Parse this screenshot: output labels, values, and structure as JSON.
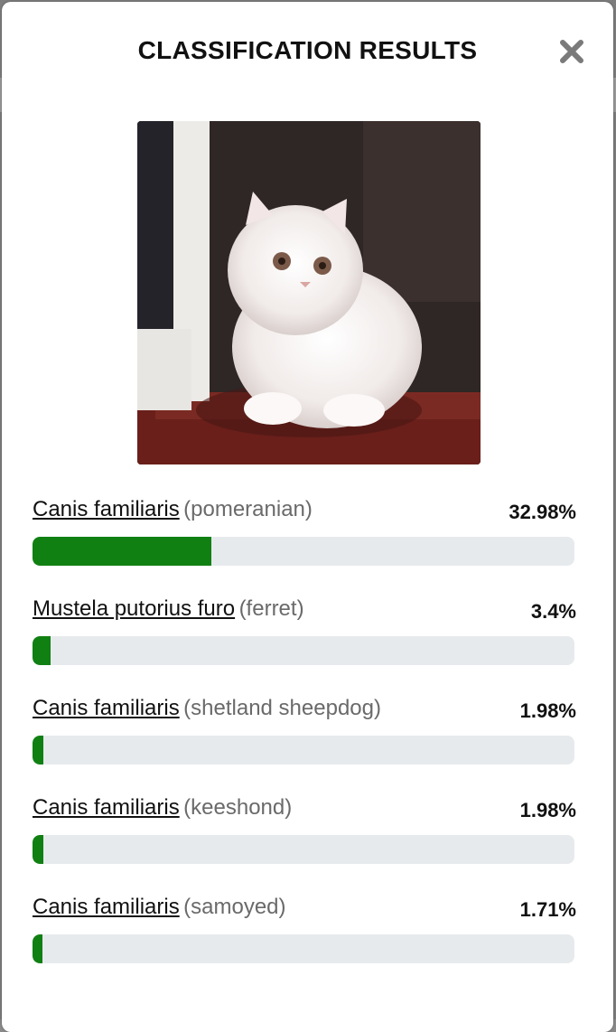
{
  "modal": {
    "title": "CLASSIFICATION RESULTS",
    "close_icon": "close-icon"
  },
  "colors": {
    "bar_fill": "#108012",
    "bar_track": "#e7eaed"
  },
  "results": [
    {
      "species": "Canis familiaris",
      "common": "(pomeranian)",
      "percent_label": "32.98%",
      "percent": 32.98
    },
    {
      "species": "Mustela putorius furo",
      "common": "(ferret)",
      "percent_label": "3.4%",
      "percent": 3.4
    },
    {
      "species": "Canis familiaris",
      "common": "(shetland sheepdog)",
      "percent_label": "1.98%",
      "percent": 1.98
    },
    {
      "species": "Canis familiaris",
      "common": "(keeshond)",
      "percent_label": "1.98%",
      "percent": 1.98
    },
    {
      "species": "Canis familiaris",
      "common": "(samoyed)",
      "percent_label": "1.71%",
      "percent": 1.71
    }
  ]
}
